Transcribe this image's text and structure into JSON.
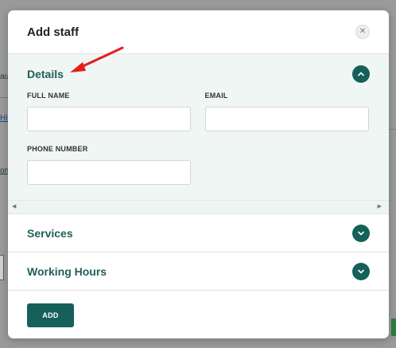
{
  "background": {
    "fragments": [
      "au",
      "Hic",
      "on"
    ]
  },
  "modal": {
    "title": "Add staff",
    "close_icon": "close-icon"
  },
  "details": {
    "title": "Details",
    "expanded": true,
    "fields": {
      "full_name_label": "FULL NAME",
      "full_name_value": "",
      "email_label": "EMAIL",
      "email_value": "",
      "phone_label": "PHONE NUMBER",
      "phone_value": ""
    }
  },
  "sections": [
    {
      "title": "Services",
      "expanded": false
    },
    {
      "title": "Working Hours",
      "expanded": false
    }
  ],
  "footer": {
    "add_label": "ADD"
  },
  "colors": {
    "accent": "#16605b",
    "section_title": "#1e5f5a",
    "details_bg": "#eff6f4",
    "annotation": "#e41e1e"
  }
}
